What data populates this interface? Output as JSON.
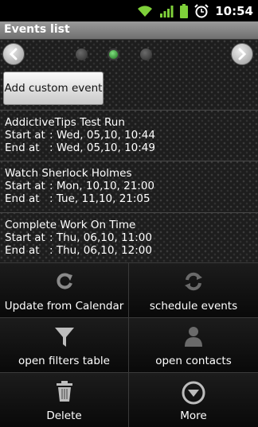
{
  "status": {
    "time": "10:54"
  },
  "title": "Events list",
  "pager": {
    "pages": 3,
    "active_index": 1
  },
  "add_button": {
    "label": "Add custom event"
  },
  "events": [
    {
      "title": "AddictiveTips Test Run",
      "start_label": "Start at",
      "start": ": Wed, 05,10, 10:44",
      "end_label": "End at",
      "end": ": Wed, 05,10, 10:49"
    },
    {
      "title": "Watch Sherlock Holmes",
      "start_label": "Start at",
      "start": ": Mon, 10,10, 21:00",
      "end_label": "End at",
      "end": ": Tue, 11,10, 21:05"
    },
    {
      "title": "Complete Work On Time",
      "start_label": "Start at",
      "start": ": Thu, 06,10, 11:00",
      "end_label": "End at",
      "end": ": Thu, 06,10, 12:00"
    }
  ],
  "menu": [
    {
      "label": "Update from Calendar",
      "icon": "refresh-icon"
    },
    {
      "label": "schedule events",
      "icon": "sync-icon"
    },
    {
      "label": "open filters table",
      "icon": "filter-icon"
    },
    {
      "label": "open contacts",
      "icon": "person-icon"
    },
    {
      "label": "Delete",
      "icon": "trash-icon"
    },
    {
      "label": "More",
      "icon": "more-icon"
    }
  ]
}
